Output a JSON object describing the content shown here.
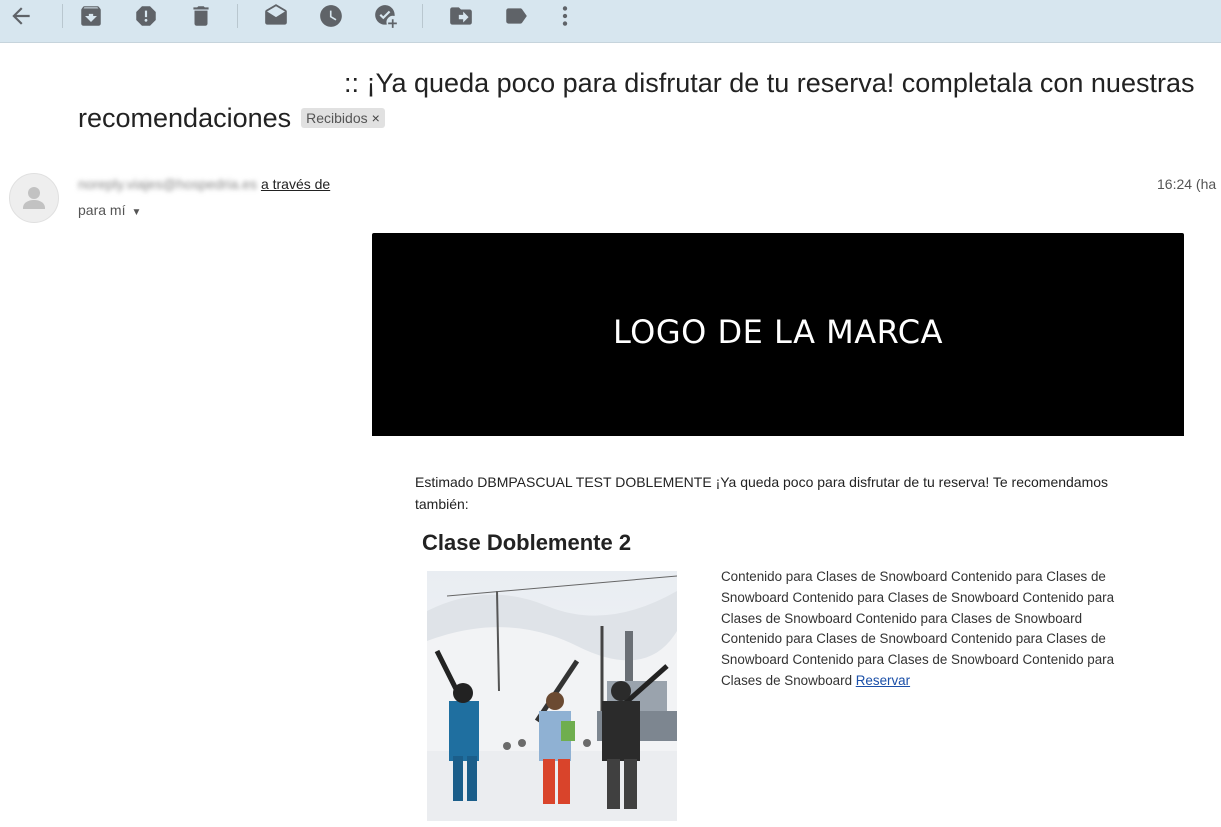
{
  "toolbar": {
    "icons": [
      "back-arrow-icon",
      "archive-icon",
      "report-spam-icon",
      "delete-icon",
      "mark-unread-icon",
      "snooze-icon",
      "add-to-tasks-icon",
      "move-to-icon",
      "labels-icon",
      "more-vert-icon"
    ]
  },
  "message": {
    "subject": ":: ¡Ya queda poco para disfrutar de tu reserva! completala con nuestras recomendaciones",
    "label": "Recibidos",
    "label_close": "×",
    "sender_blurred": "noreply.viajes@hospedria.es",
    "via": "a través de",
    "to": "para mí",
    "time": "16:24 (ha"
  },
  "email": {
    "logo_text": "LOGO DE LA MARCA",
    "greeting": "Estimado DBMPASCUAL TEST DOBLEMENTE ¡Ya queda poco para disfrutar de tu reserva! Te recomendamos también:",
    "class_title": "Clase Doblemente 2",
    "description": "Contenido para Clases de Snowboard Contenido para Clases de Snowboard Contenido para Clases de Snowboard Contenido para Clases de Snowboard Contenido para Clases de Snowboard Contenido para Clases de Snowboard Contenido para Clases de Snowboard Contenido para Clases de Snowboard Contenido para Clases de Snowboard",
    "reserve_link": "Reservar"
  },
  "colors": {
    "toolbar_bg": "#d7e6ef",
    "icon": "#5f6368",
    "banner_bg": "#000000",
    "link": "#1a4fa8"
  }
}
